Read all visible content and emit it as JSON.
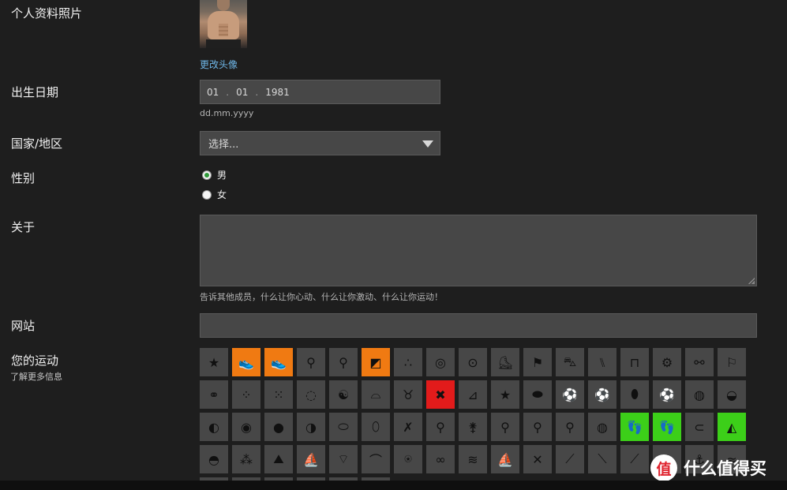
{
  "profile_photo": {
    "label": "个人资料照片",
    "change_link": "更改头像"
  },
  "birthdate": {
    "label": "出生日期",
    "day": "01",
    "month": "01",
    "year": "1981",
    "format_hint": "dd.mm.yyyy"
  },
  "country": {
    "label": "国家/地区",
    "placeholder": "选择..."
  },
  "gender": {
    "label": "性别",
    "options": [
      "男",
      "女"
    ],
    "selected": "男"
  },
  "about": {
    "label": "关于",
    "value": "",
    "hint": "告诉其他成员，什么让你心动、什么让你激动、什么让你运动！"
  },
  "website": {
    "label": "网站",
    "value": ""
  },
  "sports": {
    "label": "您的运动",
    "more_info": "了解更多信息",
    "colors": {
      "default": "#474747",
      "orange": "#f07a12",
      "red": "#e21b1b",
      "green": "#3ccf19"
    },
    "rows": [
      [
        {
          "icon": "star-icon",
          "glyph": "★",
          "state": "default"
        },
        {
          "icon": "running-shoe-icon",
          "glyph": "👟",
          "state": "orange"
        },
        {
          "icon": "running-shoe-icon",
          "glyph": "👟",
          "state": "orange"
        },
        {
          "icon": "bicycle-icon",
          "glyph": "⚲",
          "state": "default"
        },
        {
          "icon": "bicycle-icon",
          "glyph": "⚲",
          "state": "default"
        },
        {
          "icon": "orienteering-icon",
          "glyph": "◩",
          "state": "orange"
        },
        {
          "icon": "triangle-nodes-icon",
          "glyph": "∴",
          "state": "default"
        },
        {
          "icon": "target-icon",
          "glyph": "◎",
          "state": "default"
        },
        {
          "icon": "compass-icon",
          "glyph": "⊙",
          "state": "default"
        },
        {
          "icon": "inline-skate-icon",
          "glyph": "⛸",
          "state": "default"
        },
        {
          "icon": "racing-flag-icon",
          "glyph": "⚑",
          "state": "default"
        },
        {
          "icon": "kart-icon",
          "glyph": "⛍",
          "state": "default"
        },
        {
          "icon": "hurdles-icon",
          "glyph": "⑊",
          "state": "default"
        },
        {
          "icon": "pommel-horse-icon",
          "glyph": "⊓",
          "state": "default"
        },
        {
          "icon": "exercise-bike-icon",
          "glyph": "⚙",
          "state": "default"
        },
        {
          "icon": "elliptical-icon",
          "glyph": "⚯",
          "state": "default"
        },
        {
          "icon": "whistle-icon",
          "glyph": "⚐",
          "state": "default"
        }
      ],
      [
        {
          "icon": "dumbbell-icon",
          "glyph": "⚭",
          "state": "default"
        },
        {
          "icon": "dotted-ball-icon",
          "glyph": "⁘",
          "state": "default"
        },
        {
          "icon": "footprints-icon",
          "glyph": "⁙",
          "state": "default"
        },
        {
          "icon": "loading-circle-icon",
          "glyph": "◌",
          "state": "default"
        },
        {
          "icon": "yin-yang-icon",
          "glyph": "☯",
          "state": "default"
        },
        {
          "icon": "yoga-mat-icon",
          "glyph": "⌓",
          "state": "default"
        },
        {
          "icon": "kettlebell-icon",
          "glyph": "♉",
          "state": "default"
        },
        {
          "icon": "cross-icon",
          "glyph": "✖",
          "state": "red"
        },
        {
          "icon": "treadmill-icon",
          "glyph": "⊿",
          "state": "default"
        },
        {
          "icon": "star-icon",
          "glyph": "★",
          "state": "default"
        },
        {
          "icon": "puck-icon",
          "glyph": "⬬",
          "state": "default"
        },
        {
          "icon": "soccer-ball-icon",
          "glyph": "⚽",
          "state": "default"
        },
        {
          "icon": "soccer-ball-icon",
          "glyph": "⚽",
          "state": "default"
        },
        {
          "icon": "football-icon",
          "glyph": "⬮",
          "state": "default"
        },
        {
          "icon": "soccer-ball-icon",
          "glyph": "⚽",
          "state": "default"
        },
        {
          "icon": "basketball-icon",
          "glyph": "◍",
          "state": "default"
        },
        {
          "icon": "volleyball-icon",
          "glyph": "◒",
          "state": "default"
        }
      ],
      [
        {
          "icon": "tennis-ball-icon",
          "glyph": "◐",
          "state": "default"
        },
        {
          "icon": "golf-ball-icon",
          "glyph": "◉",
          "state": "default"
        },
        {
          "icon": "bowling-ball-icon",
          "glyph": "●",
          "state": "default"
        },
        {
          "icon": "baseball-icon",
          "glyph": "◑",
          "state": "default"
        },
        {
          "icon": "rugby-ball-icon",
          "glyph": "⬭",
          "state": "default"
        },
        {
          "icon": "frisbee-icon",
          "glyph": "⬯",
          "state": "default"
        },
        {
          "icon": "crossed-rackets-icon",
          "glyph": "✗",
          "state": "default"
        },
        {
          "icon": "ping-pong-icon",
          "glyph": "⚲",
          "state": "default"
        },
        {
          "icon": "badminton-icon",
          "glyph": "⚵",
          "state": "default"
        },
        {
          "icon": "table-tennis-icon",
          "glyph": "⚲",
          "state": "default"
        },
        {
          "icon": "racket-icon",
          "glyph": "⚲",
          "state": "default"
        },
        {
          "icon": "squash-icon",
          "glyph": "⚲",
          "state": "default"
        },
        {
          "icon": "golf-ball-icon",
          "glyph": "◍",
          "state": "default"
        },
        {
          "icon": "shoe-print-icon",
          "glyph": "👣",
          "state": "green"
        },
        {
          "icon": "shoe-print-icon",
          "glyph": "👣",
          "state": "green"
        },
        {
          "icon": "carabiner-icon",
          "glyph": "⊂",
          "state": "default"
        },
        {
          "icon": "climbing-icon",
          "glyph": "◭",
          "state": "green"
        }
      ],
      [
        {
          "icon": "cap-icon",
          "glyph": "◓",
          "state": "default"
        },
        {
          "icon": "ski-boot-icon",
          "glyph": "⁂",
          "state": "default"
        },
        {
          "icon": "mountain-icon",
          "glyph": "⛰",
          "state": "default"
        },
        {
          "icon": "sail-icon",
          "glyph": "⛵",
          "state": "default"
        },
        {
          "icon": "kite-icon",
          "glyph": "⌔",
          "state": "default"
        },
        {
          "icon": "diving-mask-icon",
          "glyph": "⌒",
          "state": "default"
        },
        {
          "icon": "scuba-icon",
          "glyph": "⍟",
          "state": "default"
        },
        {
          "icon": "goggles-icon",
          "glyph": "∞",
          "state": "default"
        },
        {
          "icon": "swim-goggles-icon",
          "glyph": "≋",
          "state": "default"
        },
        {
          "icon": "windsurf-icon",
          "glyph": "⛵",
          "state": "default"
        },
        {
          "icon": "crossed-oars-icon",
          "glyph": "✕",
          "state": "default"
        },
        {
          "icon": "paddle-icon",
          "glyph": "⟋",
          "state": "default"
        },
        {
          "icon": "paddle-icon",
          "glyph": "⟍",
          "state": "default"
        },
        {
          "icon": "oar-icon",
          "glyph": "⟋",
          "state": "default"
        },
        {
          "icon": "fishing-icon",
          "glyph": "⚓",
          "state": "default"
        },
        {
          "icon": "rowing-icon",
          "glyph": "⚓",
          "state": "default"
        },
        {
          "icon": "wave-icon",
          "glyph": "≈",
          "state": "default"
        }
      ],
      [
        {
          "icon": "partial-icon",
          "glyph": "",
          "state": "default"
        },
        {
          "icon": "partial-icon",
          "glyph": "",
          "state": "default"
        },
        {
          "icon": "partial-icon",
          "glyph": "",
          "state": "default"
        },
        {
          "icon": "partial-icon",
          "glyph": "",
          "state": "default"
        },
        {
          "icon": "partial-icon",
          "glyph": "",
          "state": "default"
        },
        {
          "icon": "partial-icon",
          "glyph": "",
          "state": "default"
        }
      ]
    ]
  },
  "watermark": {
    "logo": "值",
    "text": "什么值得买"
  }
}
